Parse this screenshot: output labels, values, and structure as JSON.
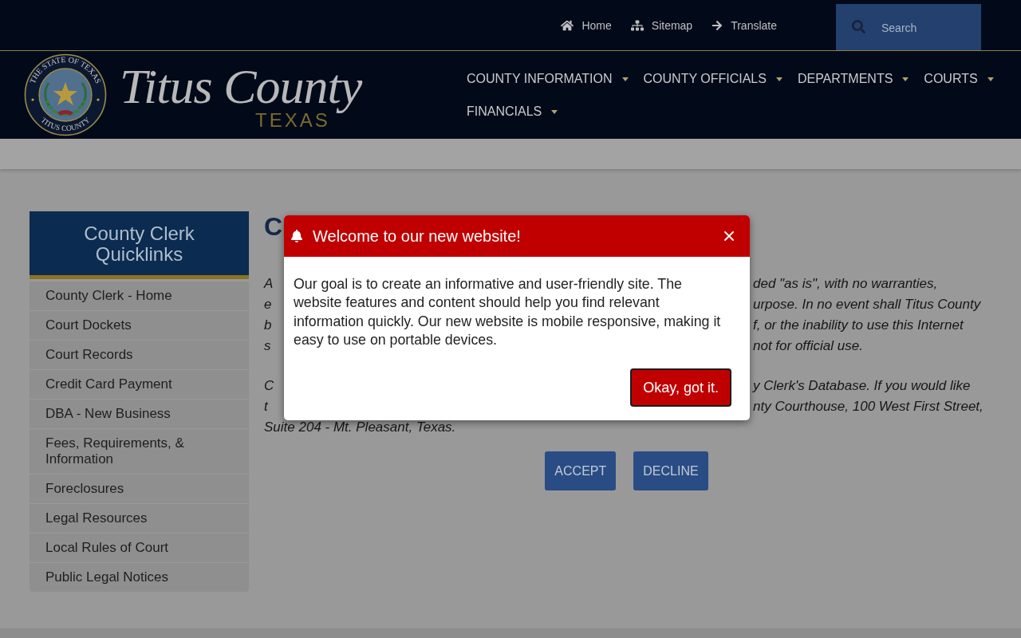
{
  "top_bar": {
    "links": [
      "Home",
      "Sitemap",
      "Translate"
    ],
    "search": {
      "placeholder": "Search"
    }
  },
  "header": {
    "seal": {
      "top_text": "THE STATE OF TEXAS",
      "bottom_text": "TITUS COUNTY"
    },
    "logo": {
      "name": "Titus County",
      "state": "TEXAS"
    },
    "nav": [
      "COUNTY INFORMATION",
      "COUNTY OFFICIALS",
      "DEPARTMENTS",
      "COURTS",
      "FINANCIALS"
    ]
  },
  "sidebar": {
    "title": "County Clerk Quicklinks",
    "items": [
      "County Clerk - Home",
      "Court Dockets",
      "Court Records",
      "Credit Card Payment",
      "DBA - New Business",
      "Fees, Requirements, & Information",
      "Foreclosures",
      "Legal Resources",
      "Local Rules of Court",
      "Public Legal Notices"
    ]
  },
  "content": {
    "heading": "C",
    "paragraphs": [
      {
        "lines": [
          {
            "left": "A",
            "right": "ded \"as is\", with no warranties,"
          },
          {
            "left": "e",
            "right": "urpose. In no event shall Titus County"
          },
          {
            "left": "b",
            "right": "f, or the inability to use this Internet"
          },
          {
            "left": "s",
            "right": "not for official use."
          }
        ]
      },
      {
        "lines": [
          {
            "left": "C",
            "right": "y Clerk's Database. If you would like"
          },
          {
            "left": "t",
            "right": "nty Courthouse, 100 West First Street,"
          },
          {
            "left": "Suite 204 - Mt. Pleasant, Texas."
          }
        ]
      }
    ],
    "buttons": [
      "ACCEPT",
      "DECLINE"
    ]
  },
  "dialog": {
    "title": "Welcome to our new website!",
    "message": "Our goal is to create an informative and user-friendly site. The website features and content should help you find relevant information quickly. Our new website is mobile responsive, making it easy to use on portable devices.",
    "button": "Okay, got it."
  }
}
